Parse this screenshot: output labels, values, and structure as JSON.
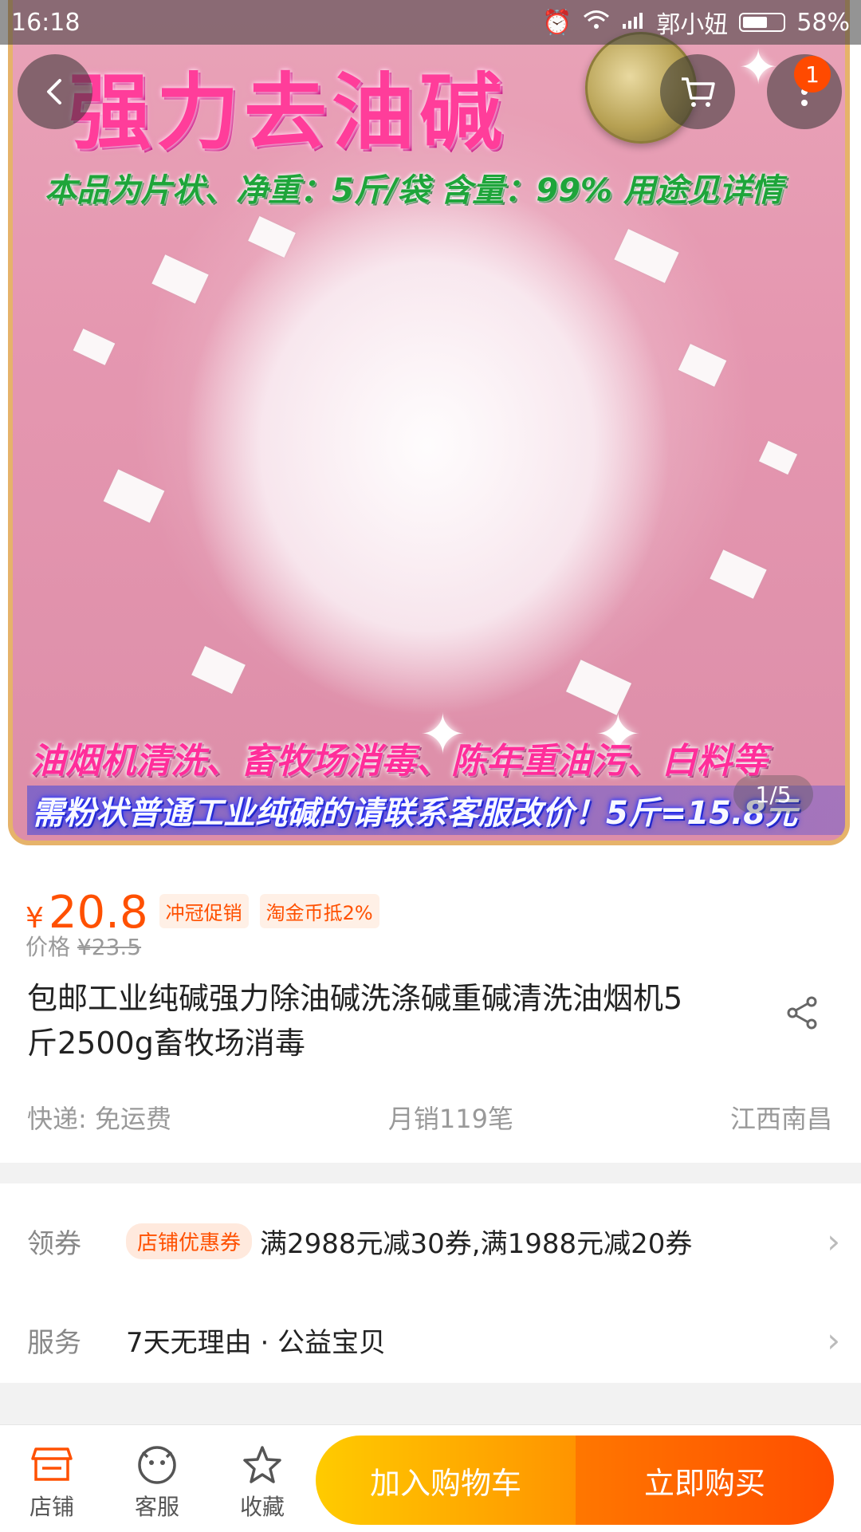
{
  "status_bar": {
    "time": "16:18",
    "carrier": "郭小妞",
    "battery": "58%"
  },
  "product_image": {
    "headline": "强力去油碱",
    "line1": "本品为片状、净重：5斤/袋 含量：99% 用途见详情",
    "line2": "油烟机清洗、畜牧场消毒、陈年重油污、白料等",
    "line3": "需粉状普通工业纯碱的请联系客服改价！5斤=15.8元",
    "pager": "1/5"
  },
  "nav": {
    "cart_badge": "1"
  },
  "price": {
    "symbol": "¥",
    "value": "20.8",
    "tags": [
      "冲冠促销",
      "淘金币抵2%"
    ],
    "original_label": "价格",
    "original_value": "¥23.5"
  },
  "title": "包邮工业纯碱强力除油碱洗涤碱重碱清洗油烟机5斤2500g畜牧场消毒",
  "meta": {
    "shipping": "快递: 免运费",
    "sales": "月销119笔",
    "location": "江西南昌"
  },
  "coupon": {
    "label": "领券",
    "tag": "店铺优惠券",
    "text": "满2988元减30券,满1988元减20券"
  },
  "service": {
    "label": "服务",
    "text": "7天无理由 · 公益宝贝"
  },
  "bottom_bar": {
    "shop": "店铺",
    "service": "客服",
    "favorite": "收藏",
    "add_to_cart": "加入购物车",
    "buy_now": "立即购买"
  },
  "colors": {
    "accent": "#ff5000",
    "cart_button": "#ffa800",
    "buy_button": "#ff5a00"
  },
  "icons": [
    "back-icon",
    "cart-icon",
    "more-icon",
    "share-icon",
    "shop-icon",
    "customer-service-icon",
    "star-icon",
    "chevron-right-icon"
  ]
}
